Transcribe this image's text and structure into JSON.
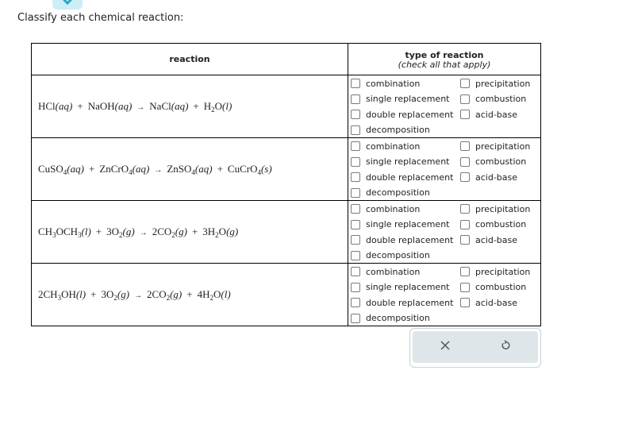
{
  "prompt": "Classify each chemical reaction:",
  "table": {
    "header_reaction": "reaction",
    "header_type": "type of reaction",
    "header_type_note": "(check all that apply)"
  },
  "options": [
    "combination",
    "single replacement",
    "double replacement",
    "decomposition",
    "precipitation",
    "combustion",
    "acid-base"
  ],
  "reactions": [
    {
      "id": 1,
      "parts": [
        {
          "t": "HCl"
        },
        {
          "t": "(aq)",
          "it": true
        },
        {
          "t": "+",
          "plus": true
        },
        {
          "t": "NaOH"
        },
        {
          "t": "(aq)",
          "it": true
        },
        {
          "arrow": true
        },
        {
          "t": "NaCl"
        },
        {
          "t": "(aq)",
          "it": true
        },
        {
          "t": "+",
          "plus": true
        },
        {
          "t": "H"
        },
        {
          "sub": "2"
        },
        {
          "t": "O"
        },
        {
          "t": "(l)",
          "it": true
        }
      ],
      "checked": []
    },
    {
      "id": 2,
      "parts": [
        {
          "t": "CuSO"
        },
        {
          "sub": "4"
        },
        {
          "t": "(aq)",
          "it": true
        },
        {
          "t": "+",
          "plus": true
        },
        {
          "t": "ZnCrO"
        },
        {
          "sub": "4"
        },
        {
          "t": "(aq)",
          "it": true
        },
        {
          "arrow": true
        },
        {
          "t": "ZnSO"
        },
        {
          "sub": "4"
        },
        {
          "t": "(aq)",
          "it": true
        },
        {
          "t": "+",
          "plus": true
        },
        {
          "t": "CuCrO"
        },
        {
          "sub": "4"
        },
        {
          "t": "(s)",
          "it": true
        }
      ],
      "checked": []
    },
    {
      "id": 3,
      "parts": [
        {
          "t": "CH"
        },
        {
          "sub": "3"
        },
        {
          "t": "OCH"
        },
        {
          "sub": "3"
        },
        {
          "t": "(l)",
          "it": true
        },
        {
          "t": "+",
          "plus": true
        },
        {
          "t": "3O"
        },
        {
          "sub": "2"
        },
        {
          "t": "(g)",
          "it": true
        },
        {
          "arrow": true
        },
        {
          "t": "2CO"
        },
        {
          "sub": "2"
        },
        {
          "t": "(g)",
          "it": true
        },
        {
          "t": "+",
          "plus": true
        },
        {
          "t": "3H"
        },
        {
          "sub": "2"
        },
        {
          "t": "O"
        },
        {
          "t": "(g)",
          "it": true
        }
      ],
      "checked": []
    },
    {
      "id": 4,
      "parts": [
        {
          "t": "2CH"
        },
        {
          "sub": "3"
        },
        {
          "t": "OH"
        },
        {
          "t": "(l)",
          "it": true
        },
        {
          "t": "+",
          "plus": true
        },
        {
          "t": "3O"
        },
        {
          "sub": "2"
        },
        {
          "t": "(g)",
          "it": true
        },
        {
          "arrow": true
        },
        {
          "t": "2CO"
        },
        {
          "sub": "2"
        },
        {
          "t": "(g)",
          "it": true
        },
        {
          "t": "+",
          "plus": true
        },
        {
          "t": "4H"
        },
        {
          "sub": "2"
        },
        {
          "t": "O"
        },
        {
          "t": "(l)",
          "it": true
        }
      ],
      "checked": []
    }
  ],
  "buttons": {
    "clear": {
      "icon": "close-icon",
      "glyph": "✕"
    },
    "undo": {
      "icon": "undo-icon"
    }
  },
  "colors": {
    "tab": "#cdeef5",
    "tab_icon": "#2aa8c4",
    "button_bar": "#dfe6e9"
  }
}
